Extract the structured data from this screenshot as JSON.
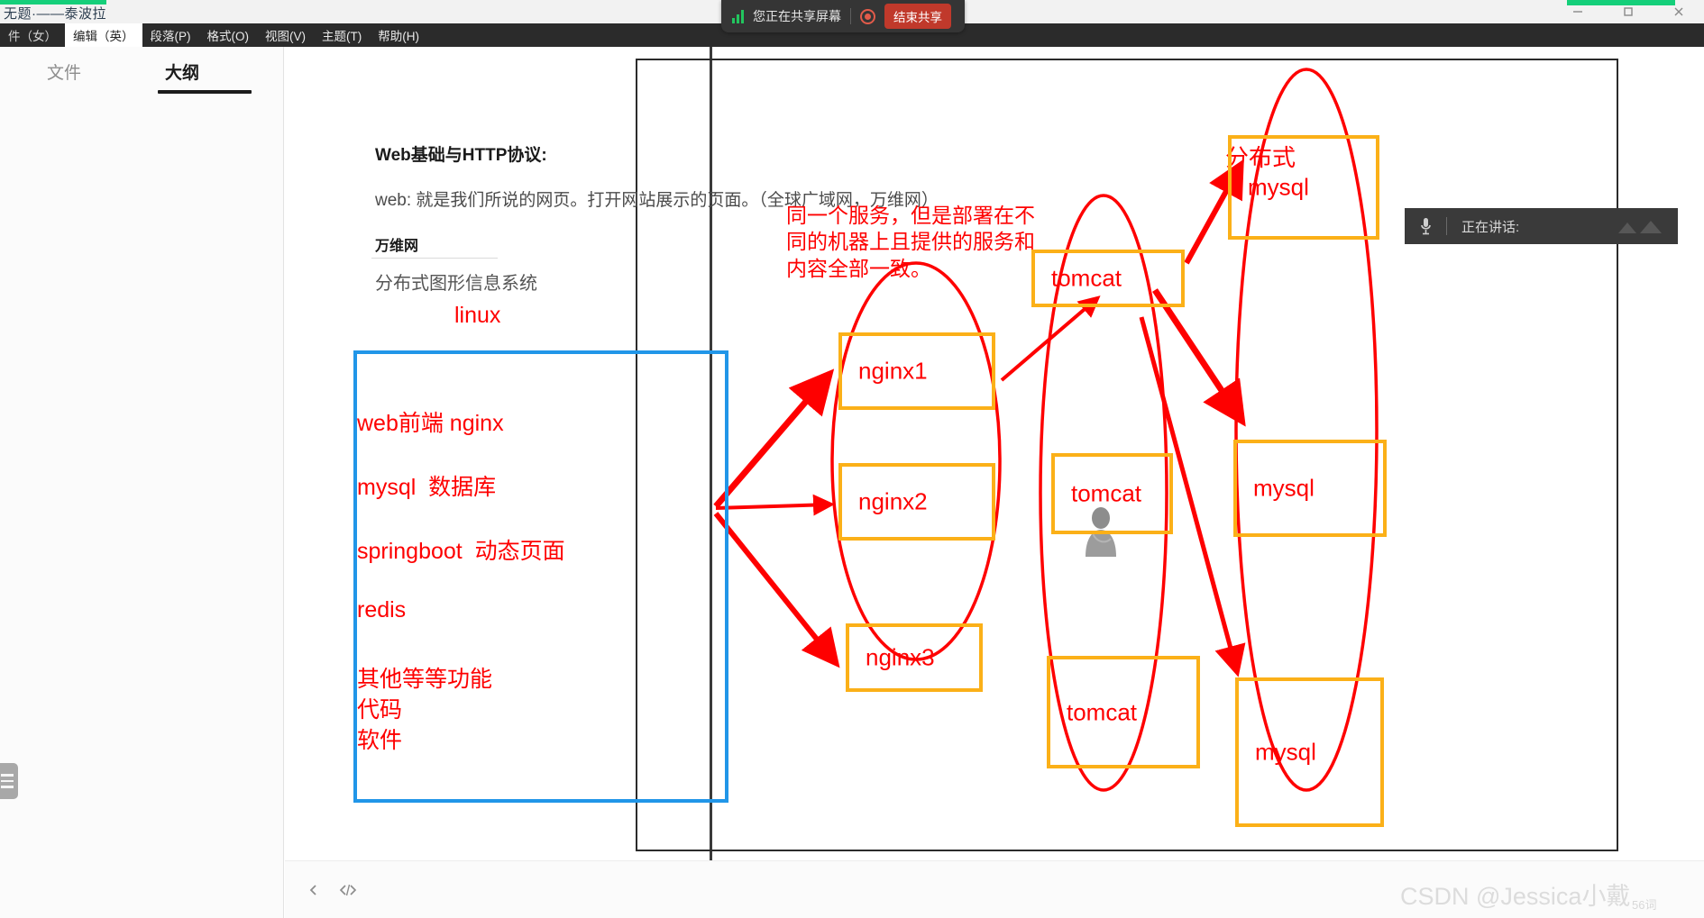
{
  "window": {
    "document_title": "无题·——泰波拉",
    "minimize_label": "minimize",
    "maximize_label": "maximize",
    "close_label": "close"
  },
  "menubar": {
    "items": [
      {
        "label": "件（女）",
        "active": false
      },
      {
        "label": "编辑（英）",
        "active": true
      },
      {
        "label": "段落(P)",
        "active": false
      },
      {
        "label": "格式(O)",
        "active": false
      },
      {
        "label": "视图(V)",
        "active": false
      },
      {
        "label": "主题(T)",
        "active": false
      },
      {
        "label": "帮助(H)",
        "active": false
      }
    ]
  },
  "share_banner": {
    "status_text": "您正在共享屏幕",
    "end_button": "结束共享",
    "signal_icon": "signal-bars-icon",
    "record_icon": "record-dot-icon"
  },
  "speaking_overlay": {
    "label": "正在讲话:",
    "mic_icon": "microphone-icon",
    "wave_icon": "audio-wave-icon"
  },
  "sidebar": {
    "tabs": [
      {
        "id": "file",
        "label": "文件",
        "active": false
      },
      {
        "id": "outline",
        "label": "大纲",
        "active": true
      }
    ],
    "handle_icon": "list-handle-icon"
  },
  "document": {
    "heading": "Web基础与HTTP协议:",
    "web_line": "web: 就是我们所说的网页。打开网站展示的页面。（全球广域网，万维网）",
    "wwwn": "万维网",
    "distributed_graphic": "分布式图形信息系统",
    "linux": "linux",
    "blue_box_items": [
      "web前端 nginx",
      "mysql  数据库",
      "springboot  动态页面",
      "redis",
      "其他等等功能",
      "代码",
      "软件"
    ]
  },
  "diagram": {
    "title": "分布式",
    "note": "同一个服务，但是部署在不\n同的机器上且提供的服务和\n内容全部一致。",
    "nodes": [
      {
        "id": "nginx1",
        "label": "nginx1"
      },
      {
        "id": "nginx2",
        "label": "nginx2"
      },
      {
        "id": "nginx3",
        "label": "nginx3"
      },
      {
        "id": "tomcat1",
        "label": "tomcat"
      },
      {
        "id": "tomcat2",
        "label": "tomcat"
      },
      {
        "id": "tomcat3",
        "label": "tomcat"
      },
      {
        "id": "mysql1",
        "label": "mysql"
      },
      {
        "id": "mysql2",
        "label": "mysql"
      },
      {
        "id": "mysql3",
        "label": "mysql"
      }
    ],
    "avatar_icon": "person-photo-icon"
  },
  "bottombar": {
    "prev_icon": "chevron-left-icon",
    "code_icon": "code-brackets-icon"
  },
  "watermark": {
    "text": "CSDN @Jessica小戴",
    "sub": "56词"
  },
  "colors": {
    "node_border": "#fbb018",
    "annotation_red": "#fe0000",
    "blue_box": "#2196e8",
    "frame_black": "#2b2b2b",
    "share_green": "#22c55e",
    "end_share_red": "#c0392b",
    "titlebar_green": "#15cf7a"
  }
}
